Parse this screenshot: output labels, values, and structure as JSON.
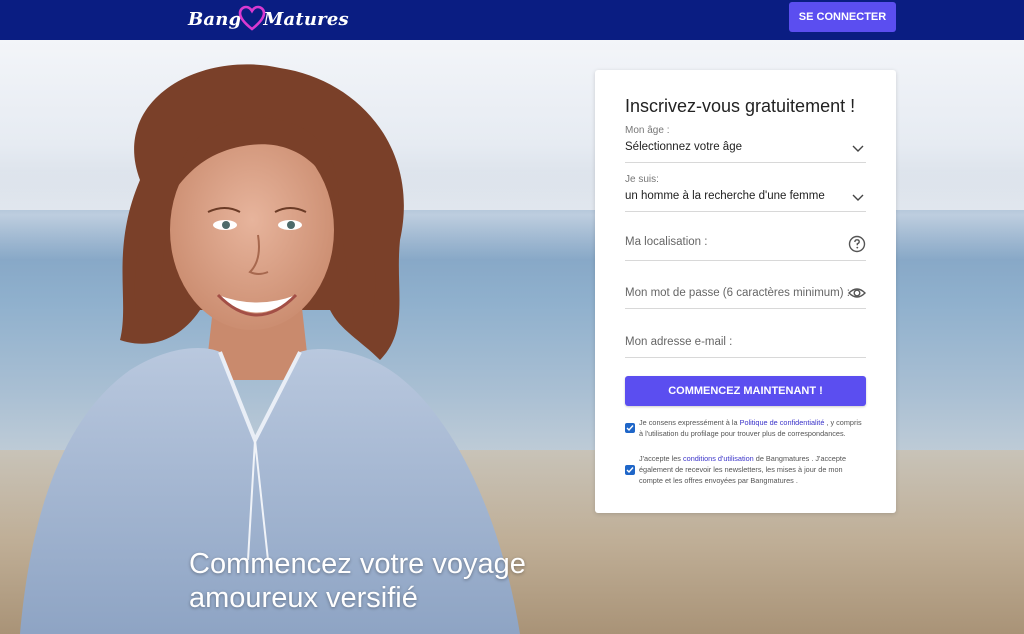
{
  "header": {
    "logo_part1": "Bang",
    "logo_part2": "Matures",
    "connect_label": "SE CONNECTER"
  },
  "hero": {
    "tagline_line1": "Commencez votre voyage",
    "tagline_line2": "amoureux versifié"
  },
  "form": {
    "title": "Inscrivez-vous gratuitement !",
    "age": {
      "label": "Mon âge :",
      "value": "Sélectionnez votre âge"
    },
    "gender": {
      "label": "Je suis:",
      "value": "un homme à la recherche d'une femme"
    },
    "location": {
      "placeholder": "Ma localisation :"
    },
    "password": {
      "placeholder": "Mon mot de passe (6 caractères minimum) :"
    },
    "email": {
      "placeholder": "Mon adresse e-mail :"
    },
    "submit_label": "COMMENCEZ MAINTENANT !",
    "consent1": {
      "checked": true,
      "pre": "Je consens expressément à la ",
      "link": "Politique de confidentialité",
      "post": " , y compris à l'utilisation du profilage pour trouver plus de correspondances."
    },
    "consent2": {
      "checked": true,
      "pre": "J'accepte les ",
      "link": "conditions d'utilisation",
      "post": " de Bangmatures . J'accepte également de recevoir les newsletters, les mises à jour de mon compte et les offres envoyées par Bangmatures ."
    }
  },
  "colors": {
    "header_bg": "#0a1d82",
    "accent": "#5b4ef0",
    "logo_heart": "#d93ad0",
    "checkbox": "#1f66c8"
  }
}
